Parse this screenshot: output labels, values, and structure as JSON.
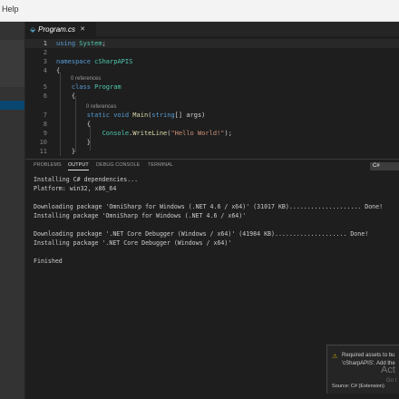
{
  "menubar": {
    "help_label": "Help"
  },
  "tab": {
    "icon": "csharp-file-icon",
    "label": "Program.cs",
    "close_glyph": "✕"
  },
  "editor": {
    "lines": [
      {
        "n": "1",
        "parts": [
          [
            "kw",
            "using "
          ],
          [
            "ty",
            "System"
          ],
          [
            "pl",
            ";"
          ]
        ]
      },
      {
        "n": "2",
        "parts": []
      },
      {
        "n": "3",
        "parts": [
          [
            "kw",
            "namespace "
          ],
          [
            "ty",
            "cSharpAPIS"
          ]
        ]
      },
      {
        "n": "4",
        "parts": [
          [
            "pl",
            "{"
          ]
        ]
      },
      {
        "n": "5",
        "parts": [
          [
            "pl",
            "    "
          ],
          [
            "kw",
            "class "
          ],
          [
            "ty",
            "Program"
          ]
        ]
      },
      {
        "n": "6",
        "parts": [
          [
            "pl",
            "    {"
          ]
        ]
      },
      {
        "n": "7",
        "parts": [
          [
            "pl",
            "        "
          ],
          [
            "kw",
            "static void "
          ],
          [
            "fn",
            "Main"
          ],
          [
            "pl",
            "("
          ],
          [
            "kw",
            "string"
          ],
          [
            "pl",
            "[] args)"
          ]
        ]
      },
      {
        "n": "8",
        "parts": [
          [
            "pl",
            "        {"
          ]
        ]
      },
      {
        "n": "9",
        "parts": [
          [
            "pl",
            "            "
          ],
          [
            "ty",
            "Console"
          ],
          [
            "pl",
            "."
          ],
          [
            "fn",
            "WriteLine"
          ],
          [
            "pl",
            "("
          ],
          [
            "str",
            "\"Hello World!\""
          ],
          [
            "pl",
            ");"
          ]
        ]
      },
      {
        "n": "10",
        "parts": [
          [
            "pl",
            "        }"
          ]
        ]
      },
      {
        "n": "11",
        "parts": [
          [
            "pl",
            "    }"
          ]
        ]
      }
    ],
    "codelens_class": "0 references",
    "codelens_method": "0 references"
  },
  "panel": {
    "tabs": [
      "PROBLEMS",
      "OUTPUT",
      "DEBUG CONSOLE",
      "TERMINAL"
    ],
    "active_tab": "OUTPUT",
    "channel": "C#",
    "output_lines": [
      "Installing C# dependencies...",
      "Platform: win32, x86_64",
      "",
      "Downloading package 'OmniSharp for Windows (.NET 4.6 / x64)' (31017 KB).................... Done!",
      "Installing package 'OmniSharp for Windows (.NET 4.6 / x64)'",
      "",
      "Downloading package '.NET Core Debugger (Windows / x64)' (41984 KB).................... Done!",
      "Installing package '.NET Core Debugger (Windows / x64)'",
      "",
      "Finished"
    ]
  },
  "notification": {
    "icon": "warning-icon",
    "line1": "Required assets to bu",
    "line2": "'cSharpAPIS'. Add the",
    "source": "Source: C# (Extension)"
  },
  "watermark": {
    "text": "Act",
    "subtext": "Go t"
  },
  "colors": {
    "accent": "#007acc",
    "warning": "#cca700",
    "selection": "#094771"
  }
}
